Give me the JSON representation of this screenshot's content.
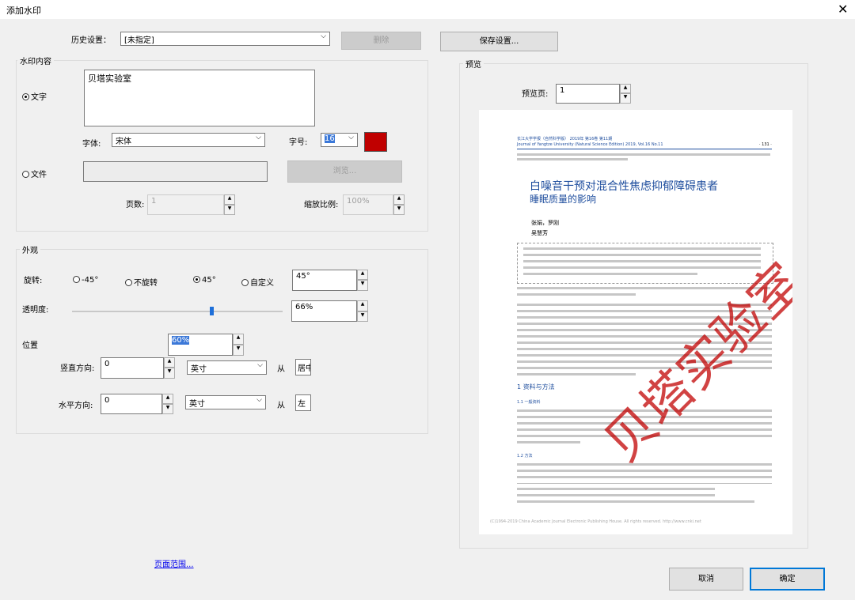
{
  "dialog": {
    "title": "添加水印"
  },
  "history": {
    "label": "历史设置：",
    "value": "[未指定]",
    "delete_label": "删除",
    "save_label": "保存设置..."
  },
  "content": {
    "group_title": "水印内容",
    "text_option": "文字",
    "text_value": "贝塔实验室",
    "font_label": "字体:",
    "font_value": "宋体",
    "size_label": "字号:",
    "size_value": "16",
    "color": "#c00000",
    "file_option": "文件",
    "browse_label": "浏览...",
    "page_label": "页数:",
    "page_value": "1",
    "scale_label": "缩放比例:",
    "scale_value": "100%"
  },
  "appearance": {
    "group_title": "外观",
    "rotation_label": "旋转:",
    "rotation_options": [
      "-45°",
      "不旋转",
      "45°",
      "自定义"
    ],
    "rotation_selected": "45°",
    "rotation_value": "45°",
    "opacity_label": "透明度:",
    "opacity_value": "66%",
    "opacity_level": 0.66,
    "floating_value": "60%"
  },
  "position": {
    "group_title": "位置",
    "vertical_label": "竖直方向:",
    "vertical_value": "0",
    "vertical_unit": "英寸",
    "vertical_from": "从",
    "vertical_anchor": "居中",
    "horizontal_label": "水平方向:",
    "horizontal_value": "0",
    "horizontal_unit": "英寸",
    "horizontal_from": "从",
    "horizontal_anchor": "左"
  },
  "preview": {
    "group_title": "预览",
    "page_label": "预览页:",
    "page_value": "1",
    "doc_title_line1": "白噪音干预对混合性焦虑抑郁障碍患者",
    "doc_title_line2": "睡眠质量的影响",
    "journal_header": "长江大学学报（自然科学版） 2019年 第16卷 第11期",
    "journal_header_en": "Journal of Yangtze University (Natural Science Edition)  2019, Vol.16 No.11",
    "page_number": "· 131 ·",
    "authors": "张娟，罗刚",
    "author2": "吴慧芳",
    "section1": "1  资料与方法",
    "sub1": "1.1  一般资料",
    "sub2": "1.2  方法",
    "footer": "(C)1994-2019 China Academic Journal Electronic Publishing House. All rights reserved.    http://www.cnki.net",
    "watermark_text": "贝塔实验室"
  },
  "footer": {
    "page_range_link": "页面范围...",
    "cancel_label": "取消",
    "ok_label": "确定"
  }
}
